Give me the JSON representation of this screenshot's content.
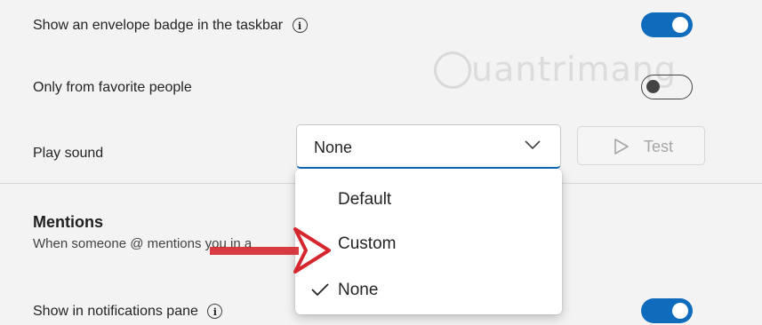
{
  "settings": {
    "envelope_badge": {
      "label": "Show an envelope badge in the taskbar",
      "info_icon": "ⓘ",
      "enabled": true
    },
    "favorites": {
      "label": "Only from favorite people",
      "enabled": false
    },
    "play_sound": {
      "label": "Play sound",
      "selected": "None",
      "options": [
        "Default",
        "Custom",
        "None"
      ],
      "test_label": "Test"
    },
    "mentions": {
      "title": "Mentions",
      "subtitle": "When someone @ mentions you in a"
    },
    "notifications_pane": {
      "label": "Show in notifications pane",
      "info_icon": "ⓘ",
      "enabled": true
    }
  },
  "watermark": {
    "text": "uantrimang"
  },
  "colors": {
    "accent": "#0f6cbd",
    "arrow": "#d6262d",
    "background": "#f3f3f3"
  },
  "icons": [
    "info-icon",
    "chevron-down-icon",
    "play-icon",
    "checkmark-icon",
    "arrow-annotation"
  ]
}
